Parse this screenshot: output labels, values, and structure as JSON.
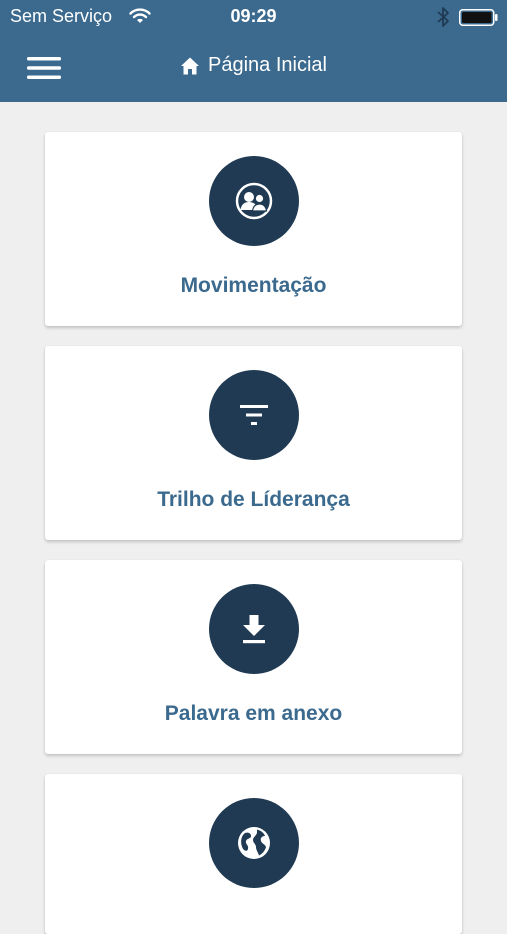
{
  "status_bar": {
    "carrier": "Sem Serviço",
    "time": "09:29"
  },
  "header": {
    "title": "Página Inicial",
    "menu_icon": "hamburger-menu-icon",
    "title_icon": "home-icon",
    "background_color": "#3b6a8e"
  },
  "cards": [
    {
      "label": "Movimentação",
      "icon": "people-icon"
    },
    {
      "label": "Trilho de Líderança",
      "icon": "filter-icon"
    },
    {
      "label": "Palavra em anexo",
      "icon": "download-icon"
    },
    {
      "label": "",
      "icon": "globe-icon"
    }
  ],
  "colors": {
    "accent": "#3b6a8e",
    "icon_circle": "#1f3a52",
    "background": "#efefef"
  }
}
